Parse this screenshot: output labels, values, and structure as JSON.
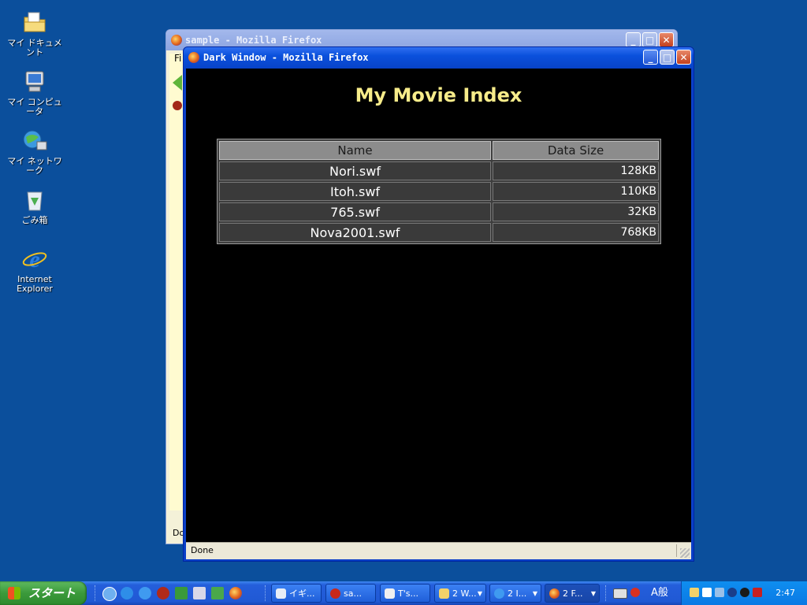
{
  "desktop": {
    "icons": [
      {
        "label": "マイ ドキュメント",
        "icon": "my-documents-icon"
      },
      {
        "label": "マイ コンピュータ",
        "icon": "my-computer-icon"
      },
      {
        "label": "マイ ネットワーク",
        "icon": "my-network-icon"
      },
      {
        "label": "ごみ箱",
        "icon": "recycle-bin-icon"
      },
      {
        "label": "Internet Explorer",
        "icon": "internet-explorer-icon"
      }
    ]
  },
  "back_window": {
    "title": "sample - Mozilla Firefox",
    "menu_first_letters": "Fi",
    "status_fragment": "Do"
  },
  "front_window": {
    "title": "Dark Window - Mozilla Firefox",
    "heading": "My Movie Index",
    "table": {
      "headers": [
        "Name",
        "Data Size"
      ],
      "rows": [
        {
          "name": "Nori.swf",
          "size": "128KB"
        },
        {
          "name": "Itoh.swf",
          "size": "110KB"
        },
        {
          "name": "765.swf",
          "size": "32KB"
        },
        {
          "name": "Nova2001.swf",
          "size": "768KB"
        }
      ]
    },
    "status": "Done"
  },
  "taskbar": {
    "start_label": "スタート",
    "buttons": [
      {
        "label": "イギ...",
        "icon": "app-icon"
      },
      {
        "label": "sa...",
        "icon": "opera-icon"
      },
      {
        "label": "T's...",
        "icon": "app-icon"
      },
      {
        "label": "2 W...",
        "icon": "folder-icon"
      },
      {
        "label": "2 I...",
        "icon": "internet-explorer-icon"
      },
      {
        "label": "2 F...",
        "icon": "firefox-icon",
        "active": true
      }
    ],
    "language_bar": "A般",
    "clock": "2:47"
  },
  "colors": {
    "heading": "#f7ec8a",
    "content_bg": "#000000",
    "header_cell_bg": "#8c8c8c",
    "body_cell_bg": "#3a3a3a",
    "desktop_bg": "#0b4f9c"
  }
}
